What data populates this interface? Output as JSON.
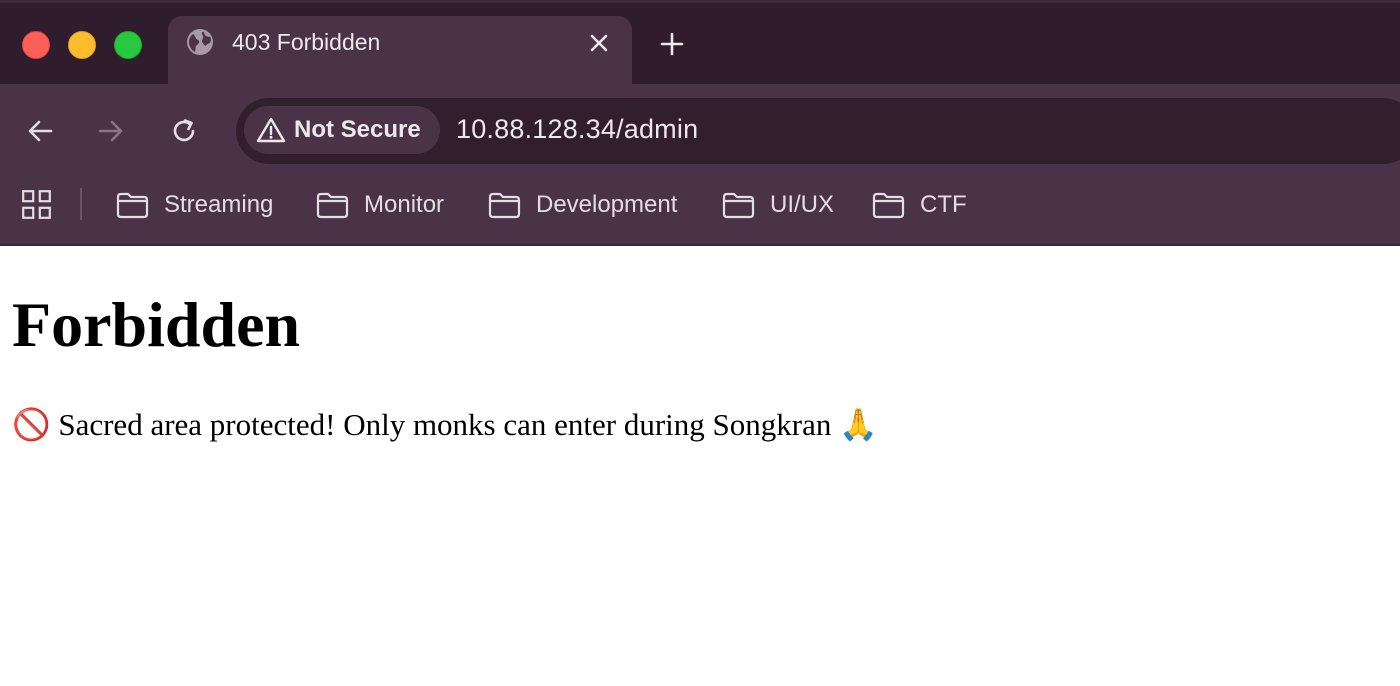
{
  "window": {
    "traffic_lights": [
      "close",
      "minimize",
      "maximize"
    ]
  },
  "tab": {
    "title": "403 Forbidden",
    "icon": "globe-icon"
  },
  "toolbar": {
    "security_label": "Not Secure",
    "url": "10.88.128.34/admin"
  },
  "bookmarks": [
    {
      "label": "Streaming"
    },
    {
      "label": "Monitor"
    },
    {
      "label": "Development"
    },
    {
      "label": "UI/UX"
    },
    {
      "label": "CTF"
    }
  ],
  "page": {
    "heading": "Forbidden",
    "message": "🚫 Sacred area protected! Only monks can enter during Songkran 🙏"
  },
  "colors": {
    "titlebar": "#2f1d2d",
    "toolbar": "#4b3347",
    "omnibox": "#311f2e",
    "text_light": "#efe6ee"
  }
}
